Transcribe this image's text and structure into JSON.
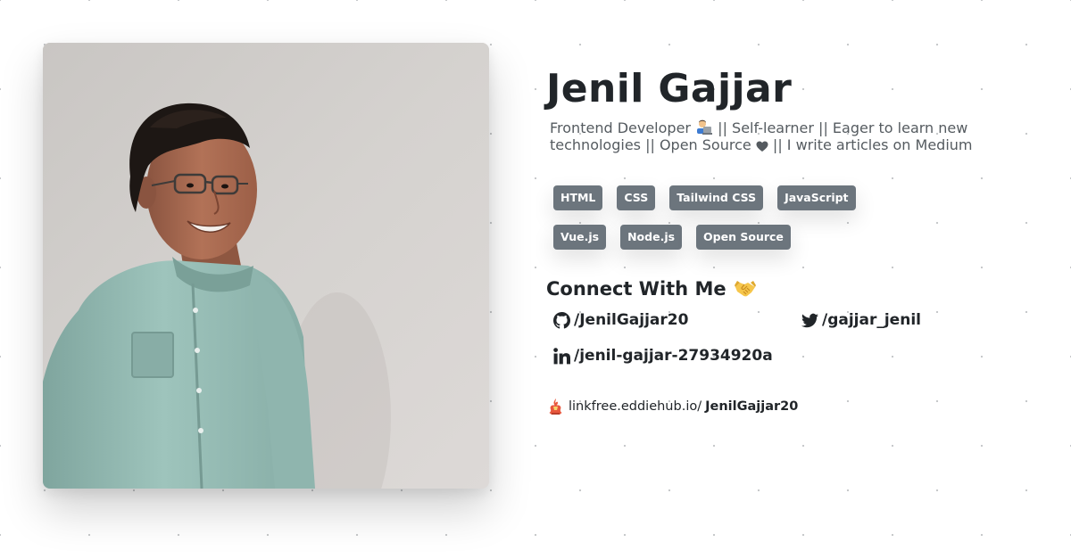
{
  "profile": {
    "name": "Jenil Gajjar",
    "bio": {
      "part1": "Frontend Developer",
      "part2": "|| Self-learner || Eager to learn new technologies || Open Source",
      "part3": "|| I write articles on Medium"
    }
  },
  "skills": [
    "HTML",
    "CSS",
    "Tailwind CSS",
    "JavaScript",
    "Vue.js",
    "Node.js",
    "Open Source"
  ],
  "connect": {
    "title": "Connect With Me",
    "github": {
      "icon": "github-icon",
      "handle": "/JenilGajjar20"
    },
    "twitter": {
      "icon": "twitter-icon",
      "handle": "/gajjar_jenil"
    },
    "linkedin": {
      "icon": "linkedin-icon",
      "handle": "/jenil-gajjar-27934920a"
    }
  },
  "linkfree": {
    "icon": "linkfree-logo-icon",
    "base": "linkfree.eddiehub.io/",
    "user": "JenilGajjar20"
  },
  "colors": {
    "badge_bg": "#6c757d",
    "text": "#212529",
    "muted": "#555b60"
  }
}
